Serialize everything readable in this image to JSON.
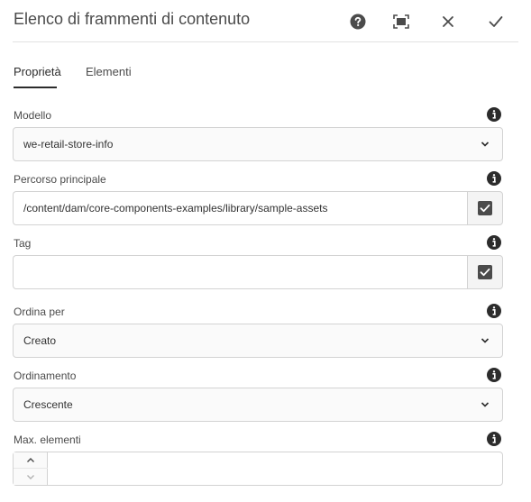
{
  "dialog": {
    "title": "Elenco di frammenti di contenuto",
    "help_icon": "help-circle-icon",
    "fullscreen_icon": "fullscreen-icon",
    "close_icon": "close-icon",
    "done_icon": "checkmark-icon"
  },
  "tabs": [
    {
      "label": "Proprietà",
      "active": true
    },
    {
      "label": "Elementi",
      "active": false
    }
  ],
  "fields": {
    "model": {
      "label": "Modello",
      "value": "we-retail-store-info"
    },
    "parent_path": {
      "label": "Percorso principale",
      "value": "/content/dam/core-components-examples/library/sample-assets"
    },
    "tags": {
      "label": "Tag",
      "value": ""
    },
    "order_by": {
      "label": "Ordina per",
      "value": "Creato"
    },
    "sort_order": {
      "label": "Ordinamento",
      "value": "Crescente"
    },
    "max_items": {
      "label": "Max. elementi",
      "value": ""
    }
  },
  "colors": {
    "accent": "#2c2c2c",
    "border": "#d3d3d3",
    "icon": "#4b4b4b"
  }
}
